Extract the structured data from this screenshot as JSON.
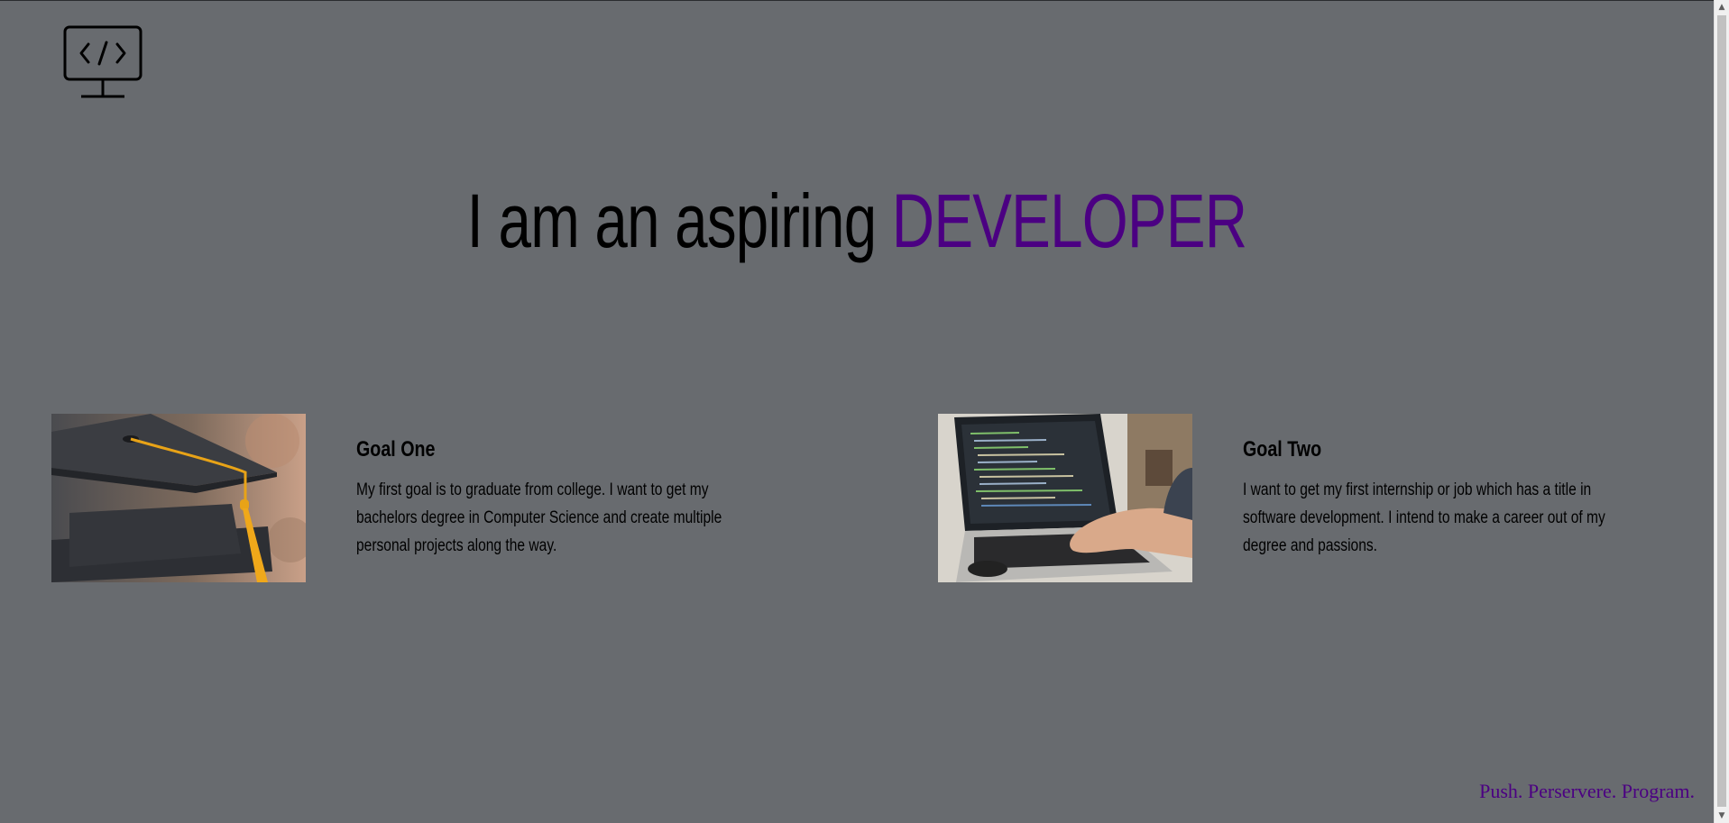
{
  "logo": {
    "icon": "code-monitor-icon"
  },
  "hero": {
    "prefix": "I am an aspiring ",
    "highlight": "DEVELOPER"
  },
  "goals": [
    {
      "title": "Goal One",
      "body": "My first goal is to graduate from college. I want to get my bachelors degree in Computer Science and create multiple personal projects along the way.",
      "image": "graduation-cap-photo"
    },
    {
      "title": "Goal Two",
      "body": "I want to get my first internship or job which has a title in software development. I intend to make a career out of my degree and passions.",
      "image": "laptop-coding-photo"
    }
  ],
  "footer": {
    "tagline": "Push. Perservere. Program."
  },
  "colors": {
    "background": "#686b6f",
    "accent": "#4b0082",
    "text": "#000000"
  }
}
